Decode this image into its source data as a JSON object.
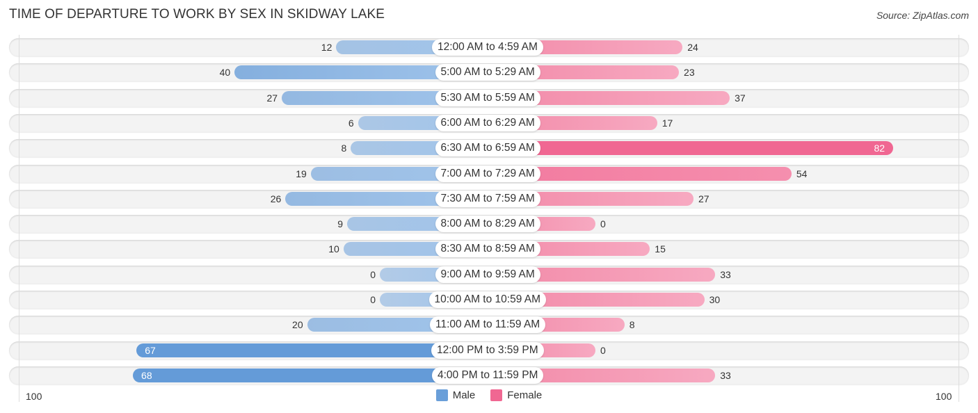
{
  "header": {
    "title": "TIME OF DEPARTURE TO WORK BY SEX IN SKIDWAY LAKE",
    "source": "Source: ZipAtlas.com"
  },
  "colors": {
    "male": "#6a9fd9",
    "female": "#f06792"
  },
  "chart_data": {
    "type": "bar",
    "orientation": "horizontal-diverging",
    "title": "TIME OF DEPARTURE TO WORK BY SEX IN SKIDWAY LAKE",
    "categories": [
      "12:00 AM to 4:59 AM",
      "5:00 AM to 5:29 AM",
      "5:30 AM to 5:59 AM",
      "6:00 AM to 6:29 AM",
      "6:30 AM to 6:59 AM",
      "7:00 AM to 7:29 AM",
      "7:30 AM to 7:59 AM",
      "8:00 AM to 8:29 AM",
      "8:30 AM to 8:59 AM",
      "9:00 AM to 9:59 AM",
      "10:00 AM to 10:59 AM",
      "11:00 AM to 11:59 AM",
      "12:00 PM to 3:59 PM",
      "4:00 PM to 11:59 PM"
    ],
    "series": [
      {
        "name": "Male",
        "values": [
          12,
          40,
          27,
          6,
          8,
          19,
          26,
          9,
          10,
          0,
          0,
          20,
          67,
          68
        ]
      },
      {
        "name": "Female",
        "values": [
          24,
          23,
          37,
          17,
          82,
          54,
          27,
          0,
          15,
          33,
          30,
          8,
          0,
          33
        ]
      }
    ],
    "axis": {
      "left_tick": "100",
      "right_tick": "100",
      "range": [
        0,
        100
      ]
    },
    "legend": {
      "position": "bottom-center",
      "entries": [
        "Male",
        "Female"
      ]
    },
    "grid": false
  }
}
